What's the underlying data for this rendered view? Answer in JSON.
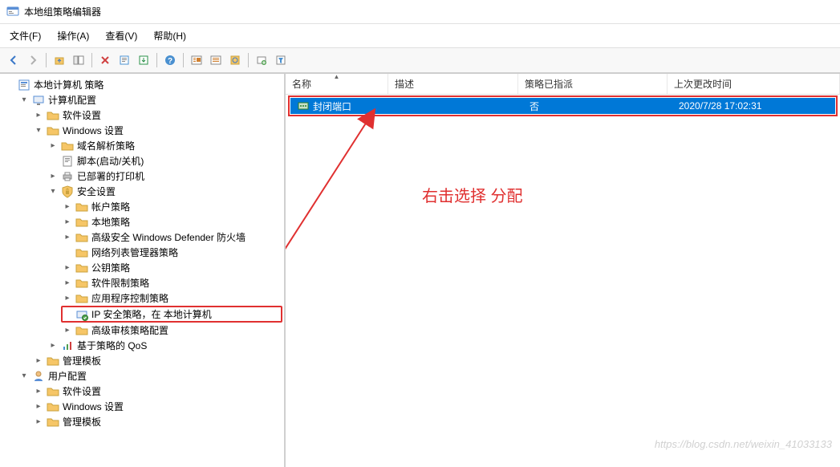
{
  "window": {
    "title": "本地组策略编辑器"
  },
  "menu": {
    "file": "文件(F)",
    "action": "操作(A)",
    "view": "查看(V)",
    "help": "帮助(H)"
  },
  "toolbar_icons": {
    "back": "back-icon",
    "forward": "forward-icon",
    "up": "up-icon",
    "show_hide": "show-hide-icon",
    "delete": "delete-icon",
    "export": "export-icon",
    "help": "help-icon",
    "properties": "properties-icon",
    "list1": "list-icon",
    "list2": "list-icon",
    "new_policy": "new-policy-icon",
    "new_filter": "new-filter-icon"
  },
  "tree": {
    "root": "本地计算机 策略",
    "computer_config": "计算机配置",
    "software_settings": "软件设置",
    "windows_settings": "Windows 设置",
    "name_resolution": "域名解析策略",
    "scripts": "脚本(启动/关机)",
    "deployed_printers": "已部署的打印机",
    "security_settings": "安全设置",
    "account_policy": "帐户策略",
    "local_policy": "本地策略",
    "defender_firewall": "高级安全 Windows Defender 防火墙",
    "network_list": "网络列表管理器策略",
    "public_key": "公钥策略",
    "software_restriction": "软件限制策略",
    "app_control": "应用程序控制策略",
    "ip_security": "IP 安全策略，在 本地计算机",
    "advanced_audit": "高级审核策略配置",
    "qos": "基于策略的 QoS",
    "admin_templates": "管理模板",
    "user_config": "用户配置",
    "user_software": "软件设置",
    "user_windows": "Windows 设置",
    "user_templates": "管理模板"
  },
  "list": {
    "headers": {
      "name": "名称",
      "description": "描述",
      "assigned": "策略已指派",
      "last_changed": "上次更改时间"
    },
    "rows": [
      {
        "name": "封闭端口",
        "description": "",
        "assigned": "否",
        "last_changed": "2020/7/28 17:02:31"
      }
    ]
  },
  "annotation": {
    "text": "右击选择 分配"
  },
  "watermark": "https://blog.csdn.net/weixin_41033133"
}
